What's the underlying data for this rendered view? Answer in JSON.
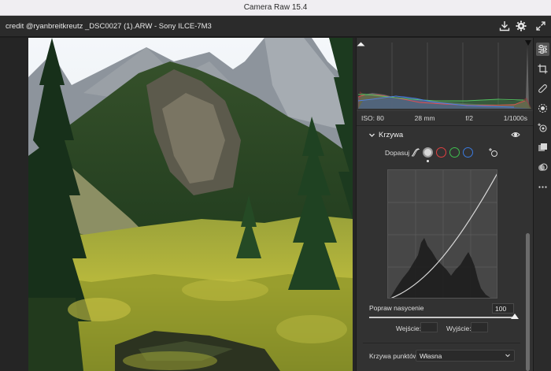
{
  "window": {
    "title": "Camera Raw 15.4"
  },
  "header": {
    "file_info": "credit @ryanbreitkreutz _DSC0027 (1).ARW  -  Sony ILCE-7M3",
    "icons": [
      "save-icon",
      "gear-icon",
      "fullscreen-icon"
    ]
  },
  "exif": {
    "iso": "ISO: 80",
    "focal": "28 mm",
    "aperture": "f/2",
    "shutter": "1/1000s"
  },
  "curve_section": {
    "title": "Krzywa",
    "adjust_label": "Dopasuj",
    "channels": [
      "parametric",
      "point-white",
      "red",
      "green",
      "blue"
    ],
    "saturation_label": "Popraw nasycenie",
    "saturation_value": "100",
    "input_label": "Wejście:",
    "output_label": "Wyjście:",
    "input_value": "",
    "output_value": "",
    "point_curve_label": "Krzywa punktów",
    "point_curve_value": "Własna",
    "saturation_level": 1.0
  },
  "colors": {
    "channel_red": "#e04040",
    "channel_green": "#3fbf4f",
    "channel_blue": "#3b7be0",
    "panel_bg": "#323232"
  },
  "toolbar": [
    "sliders-icon",
    "crop-icon",
    "healing-icon",
    "mask-icon",
    "redeye-icon",
    "presets-icon",
    "snapshots-icon",
    "more-icon"
  ]
}
